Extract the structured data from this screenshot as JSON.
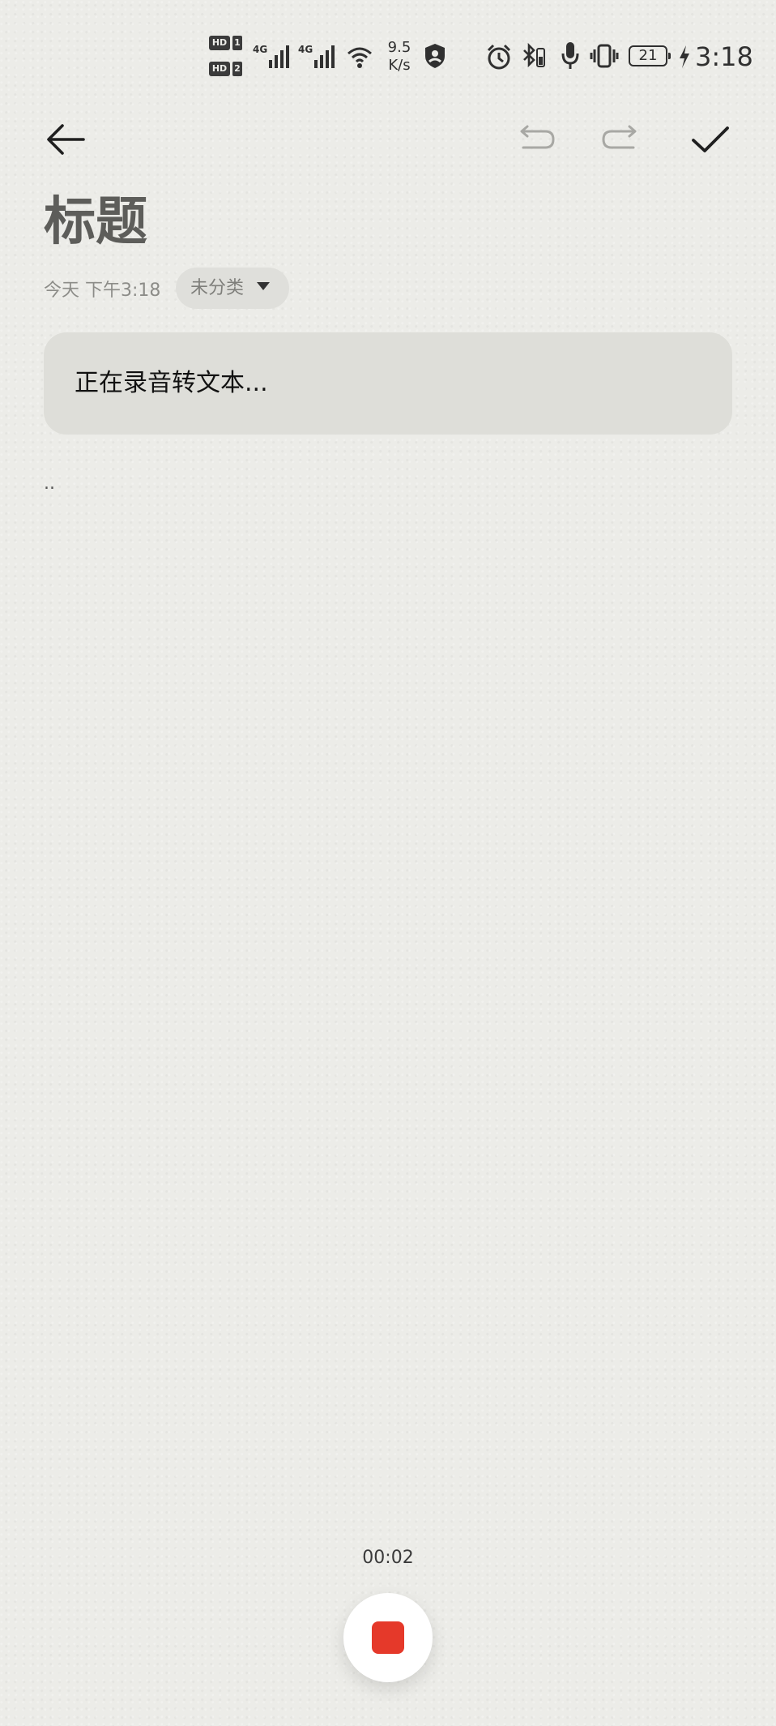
{
  "status_bar": {
    "hd1": "HD",
    "hd1_num": "1",
    "hd2": "HD",
    "hd2_num": "2",
    "network1": "4G",
    "network2": "4G",
    "speed_value": "9.5",
    "speed_unit": "K/s",
    "battery": "21",
    "time": "3:18",
    "icons": [
      "signal-bars-icon",
      "wifi-icon",
      "vpn-shield-icon",
      "alarm-icon",
      "bluetooth-battery-icon",
      "microphone-icon",
      "vibrate-icon",
      "charging-icon"
    ]
  },
  "toolbar": {
    "back": "back-arrow-icon",
    "undo": "undo-icon",
    "redo": "redo-icon",
    "done": "checkmark-icon"
  },
  "note": {
    "title": "标题",
    "date": "今天 下午3:18",
    "category": "未分类",
    "recording_status": "正在录音转文本...",
    "content": ".."
  },
  "recorder": {
    "timer": "00:02",
    "stop_icon": "stop-icon",
    "accent": "#e5392a"
  }
}
